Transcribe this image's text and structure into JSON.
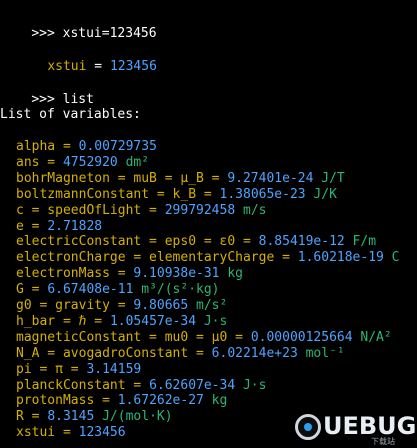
{
  "colors": {
    "background": "#000000",
    "prompt": "#ffffff",
    "variable": "#d4b000",
    "number": "#4fa3ff",
    "unit": "#2bb673"
  },
  "session": {
    "cmd1": {
      "prompt": ">>>",
      "command": "xstui=123456"
    },
    "result1": {
      "name": "xstui",
      "eq": " = ",
      "value": "123456"
    },
    "cmd2": {
      "prompt": ">>>",
      "command": "list"
    },
    "list_header": "List of variables:",
    "variables": [
      {
        "name": "alpha",
        "rest": " = ",
        "value": "0.00729735",
        "unit": ""
      },
      {
        "name": "ans",
        "rest": " = ",
        "value": "4752920",
        "unit": " dm²"
      },
      {
        "name": "bohrMagneton",
        "rest": " = muB = μ_B = ",
        "value": "9.27401e-24",
        "unit": " J/T"
      },
      {
        "name": "boltzmannConstant",
        "rest": " = k_B = ",
        "value": "1.38065e-23",
        "unit": " J/K"
      },
      {
        "name": "c",
        "rest": " = speedOfLight = ",
        "value": "299792458",
        "unit": " m/s"
      },
      {
        "name": "e",
        "rest": " = ",
        "value": "2.71828",
        "unit": ""
      },
      {
        "name": "electricConstant",
        "rest": " = eps0 = ε0 = ",
        "value": "8.85419e-12",
        "unit": " F/m"
      },
      {
        "name": "electronCharge",
        "rest": " = elementaryCharge = ",
        "value": "1.60218e-19",
        "unit": " C"
      },
      {
        "name": "electronMass",
        "rest": " = ",
        "value": "9.10938e-31",
        "unit": " kg"
      },
      {
        "name": "G",
        "rest": " = ",
        "value": "6.67408e-11",
        "unit": " m³/(s²·kg)"
      },
      {
        "name": "g0",
        "rest": " = gravity = ",
        "value": "9.80665",
        "unit": " m/s²"
      },
      {
        "name": "h_bar",
        "rest": " = ℏ = ",
        "value": "1.05457e-34",
        "unit": " J·s"
      },
      {
        "name": "magneticConstant",
        "rest": " = mu0 = μ0 = ",
        "value": "0.00000125664",
        "unit": " N/A²"
      },
      {
        "name": "N_A",
        "rest": " = avogadroConstant = ",
        "value": "6.02214e+23",
        "unit": " mol⁻¹"
      },
      {
        "name": "pi",
        "rest": " = π = ",
        "value": "3.14159",
        "unit": ""
      },
      {
        "name": "planckConstant",
        "rest": " = ",
        "value": "6.62607e-34",
        "unit": " J·s"
      },
      {
        "name": "protonMass",
        "rest": " = ",
        "value": "1.67262e-27",
        "unit": " kg"
      },
      {
        "name": "R",
        "rest": " = ",
        "value": "8.3145",
        "unit": " J/(mol·K)"
      },
      {
        "name": "xstui",
        "rest": " = ",
        "value": "123456",
        "unit": ""
      }
    ]
  },
  "watermark": {
    "logo_text": "UEBUG",
    "sub_text": "下载站"
  }
}
